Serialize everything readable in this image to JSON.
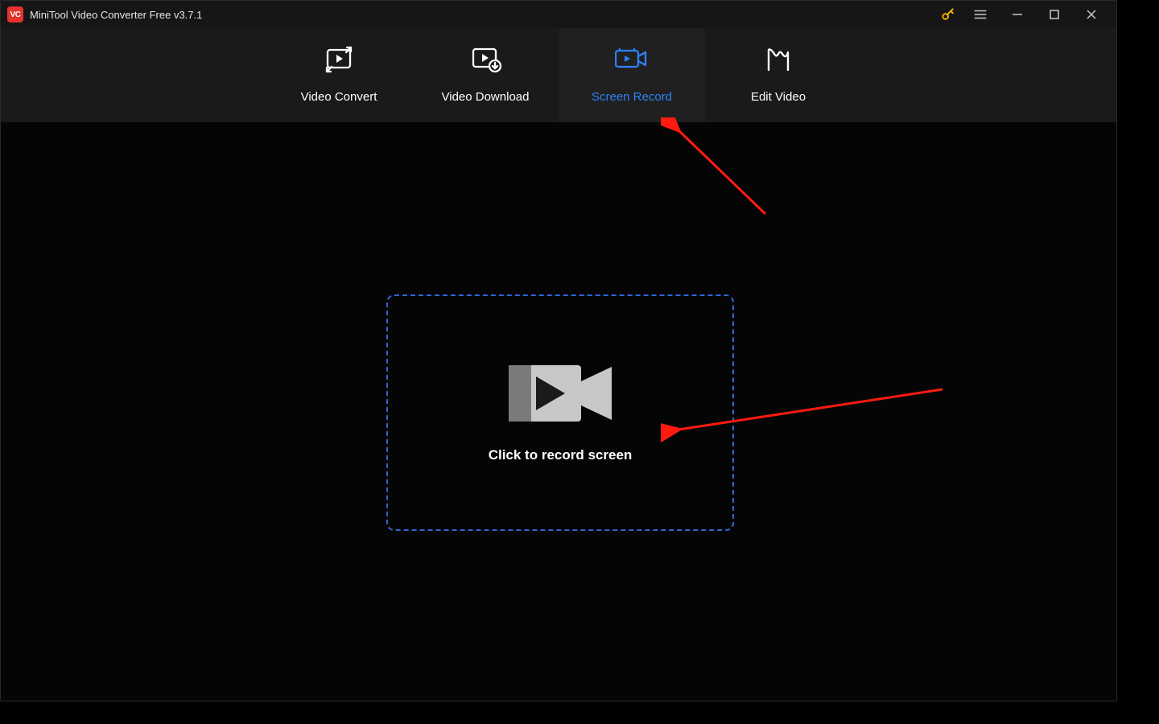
{
  "app": {
    "logo_text": "VC",
    "title": "MiniTool Video Converter Free v3.7.1"
  },
  "tabs": [
    {
      "id": "video-convert",
      "label": "Video Convert",
      "active": false
    },
    {
      "id": "video-download",
      "label": "Video Download",
      "active": false
    },
    {
      "id": "screen-record",
      "label": "Screen Record",
      "active": true
    },
    {
      "id": "edit-video",
      "label": "Edit Video",
      "active": false
    }
  ],
  "main": {
    "record_cta": "Click to record screen"
  },
  "colors": {
    "accent": "#2f81f7",
    "dashed_border": "#2f66d6",
    "annotation": "#ff1b0f"
  }
}
